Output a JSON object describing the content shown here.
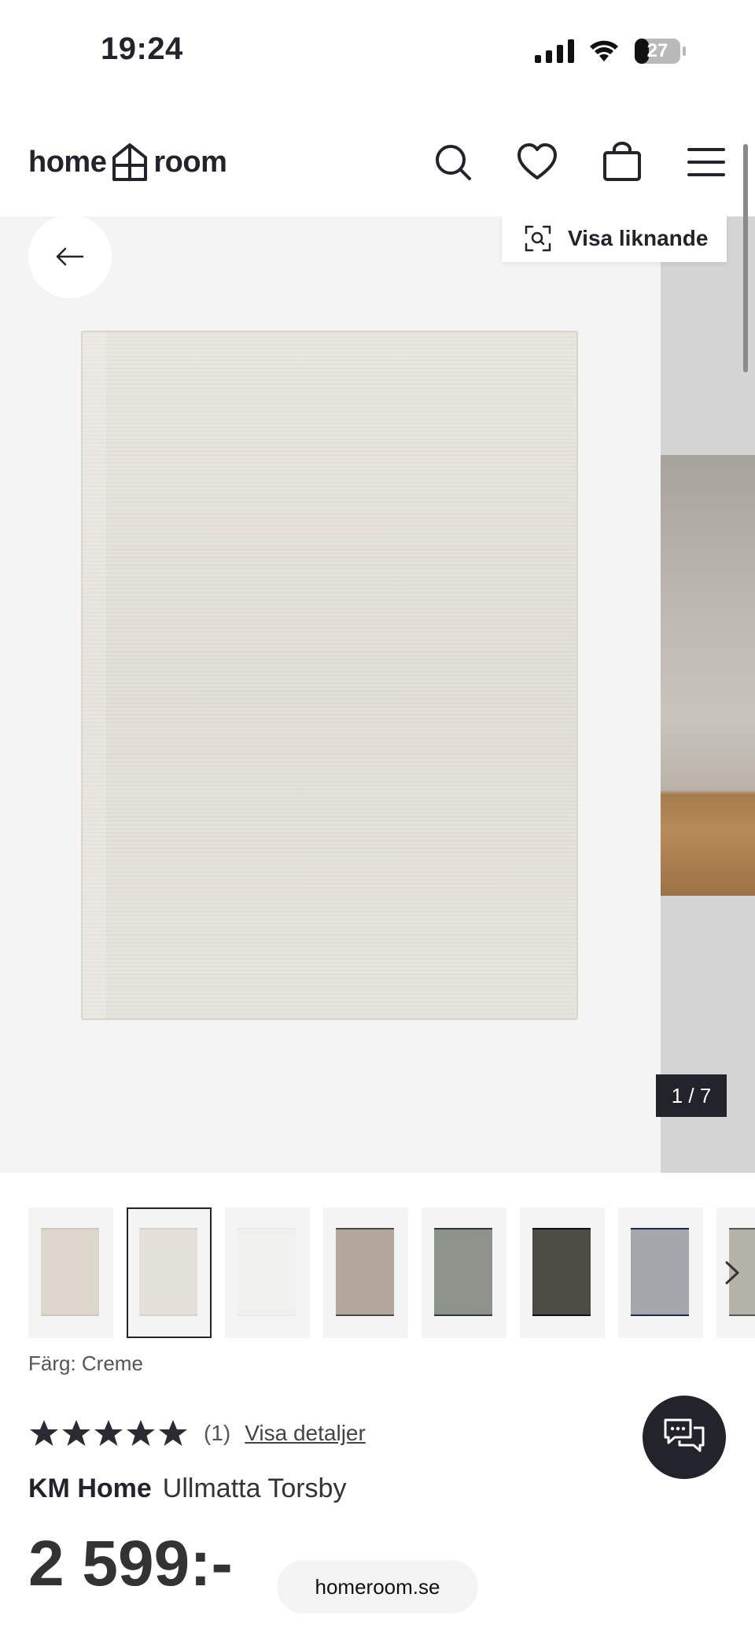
{
  "status_bar": {
    "time": "19:24",
    "battery_level": "27"
  },
  "header": {
    "logo_left": "home",
    "logo_right": "room",
    "icons": [
      "search-icon",
      "heart-icon",
      "bag-icon",
      "menu-icon"
    ]
  },
  "gallery": {
    "similar_label": "Visa liknande",
    "counter": "1 / 7"
  },
  "thumbnails": [
    {
      "color": "#dcd6cc",
      "border": "#cfc8bc",
      "selected": false
    },
    {
      "color": "#e3e0da",
      "border": "#d6d2ca",
      "selected": true
    },
    {
      "color": "#f0f0ee",
      "border": "#e8e8e5",
      "selected": false
    },
    {
      "color": "#b3a79b",
      "border": "#4a4a4a",
      "selected": false
    },
    {
      "color": "#8d928b",
      "border": "#2f3340",
      "selected": false
    },
    {
      "color": "#4e4a44",
      "border": "#111111",
      "selected": false
    },
    {
      "color": "#a3a6aa",
      "border": "#1e2a44",
      "selected": false
    },
    {
      "color": "#b5b3a8",
      "border": "#555555",
      "selected": false
    }
  ],
  "product": {
    "color_label": "Färg: Creme",
    "rating_stars": 5,
    "rating_count": "(1)",
    "rating_link": "Visa detaljer",
    "brand": "KM Home",
    "name": "Ullmatta Torsby",
    "price": "2 599:-"
  },
  "browser": {
    "url": "homeroom.se"
  },
  "colors": {
    "primary_dark": "#23232b",
    "gallery_bg": "#f4f4f4"
  }
}
